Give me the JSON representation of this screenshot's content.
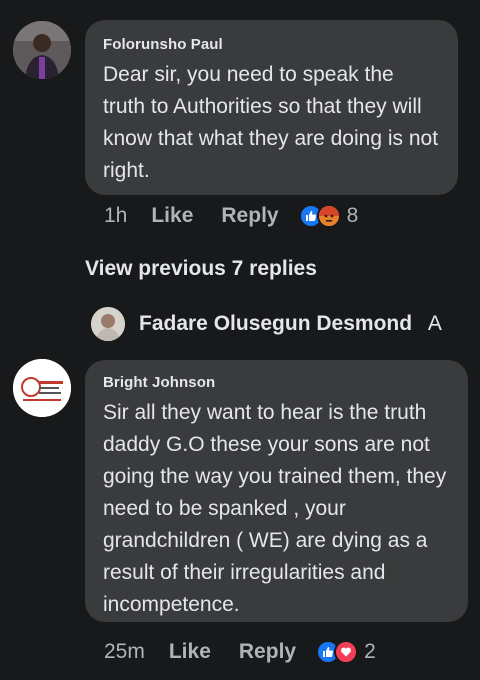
{
  "comments": [
    {
      "author": "Folorunsho Paul",
      "text": "Dear sir, you need to  speak the truth to Authorities so that they will know that what they are doing is not right.",
      "time": "1h",
      "like_label": "Like",
      "reply_label": "Reply",
      "reactions": [
        "like",
        "angry"
      ],
      "reaction_count": "8"
    },
    {
      "author": "Bright Johnson",
      "text": "Sir all they want to hear is the truth daddy G.O these your sons are not going the way you trained them, they need to be spanked , your grandchildren ( WE) are dying as a result of their irregularities and incompetence.",
      "time": "25m",
      "like_label": "Like",
      "reply_label": "Reply",
      "reactions": [
        "like",
        "love"
      ],
      "reaction_count": "2"
    }
  ],
  "view_previous": "View previous 7 replies",
  "collapsed_reply": {
    "author": "Fadare Olusegun Desmond",
    "trailing_glyph": "A"
  },
  "colors": {
    "background": "#18191a",
    "bubble": "#3a3b3c",
    "text": "#e4e6eb",
    "secondary": "#b0b3b8",
    "like_blue": "#1877f2",
    "love_red": "#f33e58",
    "angry_orange": "#e8822a"
  }
}
